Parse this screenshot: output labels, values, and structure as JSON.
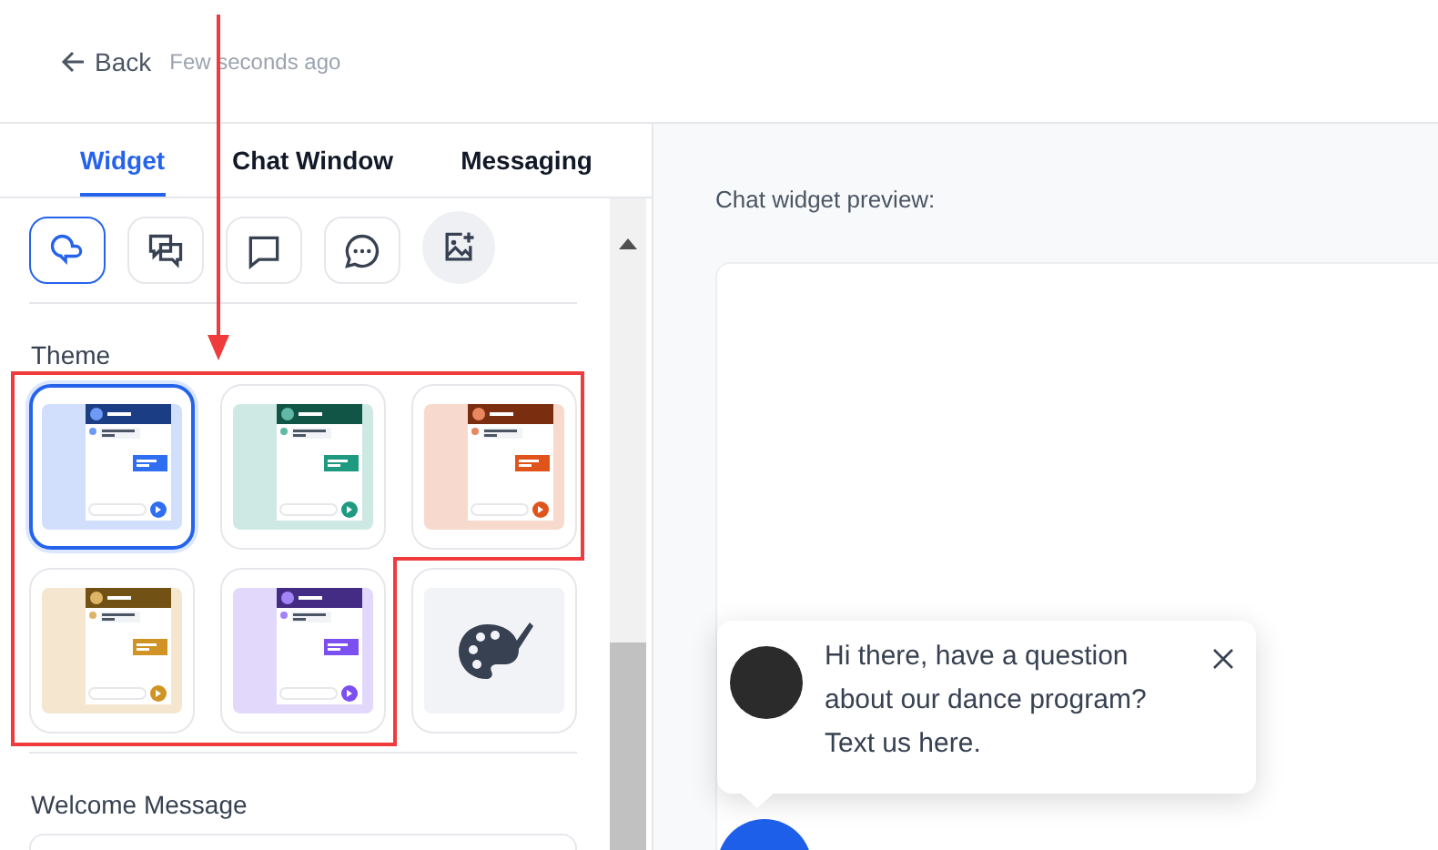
{
  "header": {
    "back": "Back",
    "saved": "Few seconds ago"
  },
  "tabs": [
    {
      "label": "Widget",
      "selected": true
    },
    {
      "label": "Chat Window",
      "selected": false
    },
    {
      "label": "Messaging",
      "selected": false
    }
  ],
  "icon_styles": [
    {
      "kind": "bubbles-round",
      "selected": true
    },
    {
      "kind": "bubbles-square",
      "selected": false
    },
    {
      "kind": "bubble",
      "selected": false
    },
    {
      "kind": "bubble-dots",
      "selected": false
    },
    {
      "kind": "upload",
      "selected": false
    }
  ],
  "theme": {
    "label": "Theme",
    "options": [
      {
        "kind": "preset",
        "color": "#2f6ef0",
        "selected": true
      },
      {
        "kind": "preset",
        "color": "#1e9a80",
        "selected": false
      },
      {
        "kind": "preset",
        "color": "#e0541c",
        "selected": false
      },
      {
        "kind": "preset",
        "color": "#d09424",
        "selected": false
      },
      {
        "kind": "preset",
        "color": "#7b4ff0",
        "selected": false
      },
      {
        "kind": "custom",
        "selected": false
      }
    ]
  },
  "welcome": {
    "label": "Welcome Message"
  },
  "preview": {
    "label": "Chat widget preview:",
    "message": "Hi there, have a question about our dance program? Text us here."
  }
}
